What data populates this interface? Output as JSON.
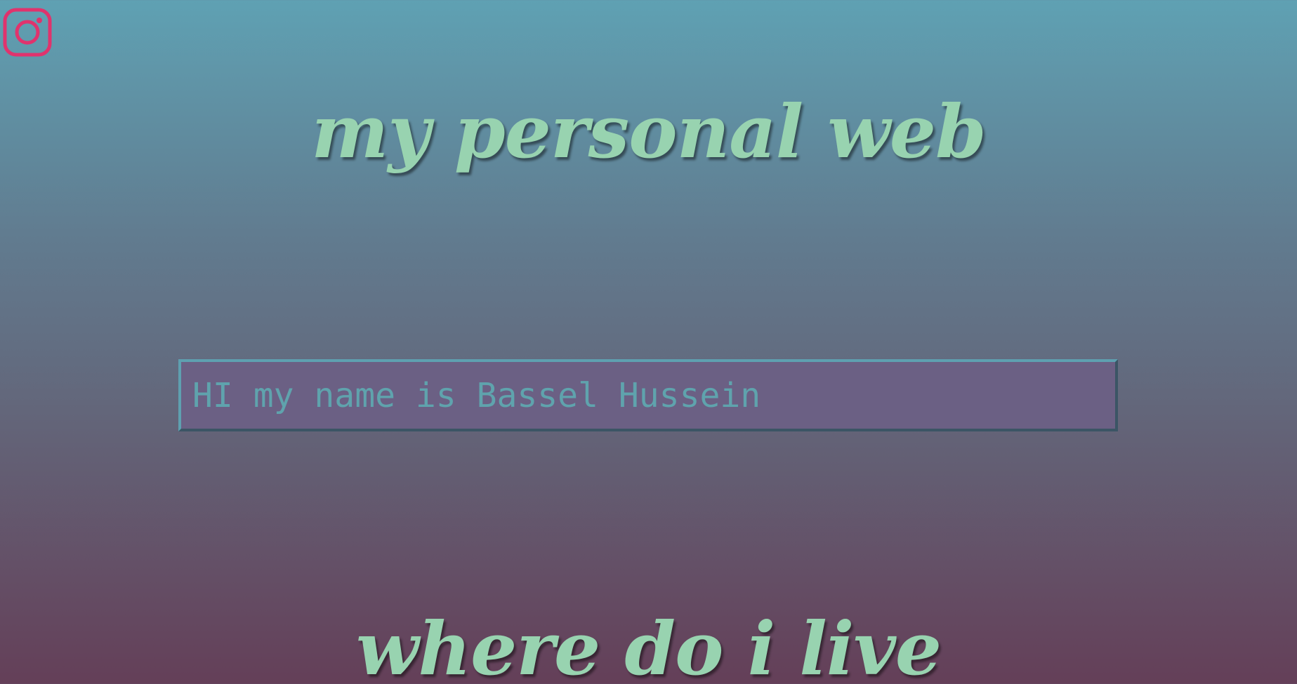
{
  "social": {
    "icon": "instagram-icon",
    "color": "#e0336d"
  },
  "header": {
    "title": "my personal web"
  },
  "intro": {
    "text": "HI my name is Bassel Hussein"
  },
  "section": {
    "heading": "where do i live"
  },
  "colors": {
    "title_text": "#98d3b0",
    "box_bg": "#6b6084",
    "box_text": "#5fa3ad",
    "gradient_top": "#5fa1b3",
    "gradient_bottom": "#643f58"
  }
}
